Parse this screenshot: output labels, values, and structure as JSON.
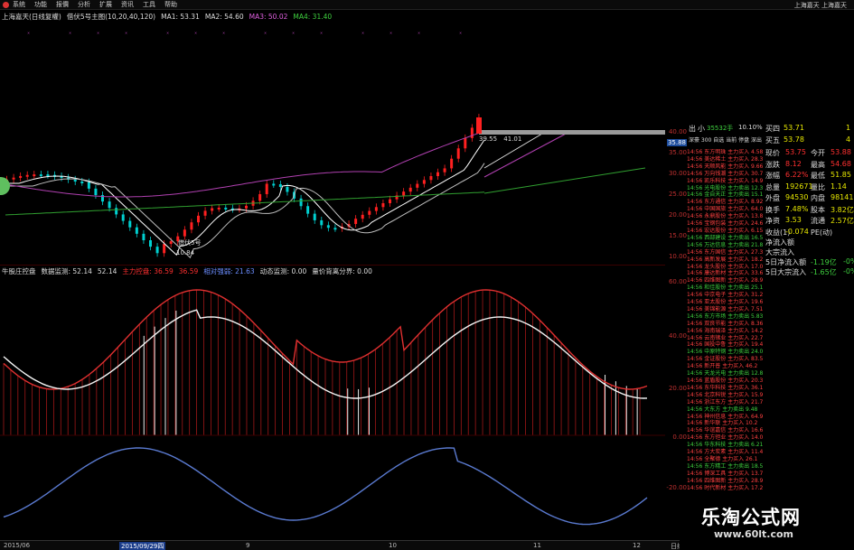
{
  "menu": {
    "items": [
      "系统",
      "功能",
      "报價",
      "分析",
      "扩展",
      "资讯",
      "工具",
      "帮助"
    ],
    "window_title": "上海嘉天  上海嘉天"
  },
  "main_info": {
    "name": "上海嘉天(日线复權)",
    "indicator": "借伏5号主图(10,20,40,120)",
    "ma1": "MA1: 53.31",
    "ma2": "MA2: 54.60",
    "ma3": "MA3: 50.02",
    "ma4": "MA4: 31.40"
  },
  "sub_info": {
    "name": "牛股庄控盘",
    "v1": "数据监测: 52.14",
    "v2": "52.14",
    "v3": "主力控盘: 36.59",
    "v4": "36.59",
    "v5": "相对强弱: 21.63",
    "v6": "动态监测: 0.00",
    "v7": "量价背离分界: 0.00"
  },
  "price_labels": {
    "high_left": "39.55",
    "high_right": "41.01",
    "low": "10.84",
    "buy_label": "借伏5号"
  },
  "price_axis": [
    "40.00",
    "35.00",
    "30.00",
    "25.00",
    "20.00",
    "15.00",
    "10.00"
  ],
  "price_axis_marker": "35.88",
  "sub_axis": [
    "60.00",
    "40.00",
    "20.00",
    "0.00",
    "-20.00"
  ],
  "side_panel": {
    "top_left": "出",
    "top_mid": "小",
    "top_vol": "35532手",
    "top_pct": "10.10%",
    "stock_line": "深豪 300  自选 当前 停盘 深出",
    "buy4_label": "买四",
    "buy4_price": "53.71",
    "buy4_vol": "1",
    "buy5_label": "买五",
    "buy5_price": "53.78",
    "buy5_vol": "4",
    "rows": [
      {
        "l": "现价",
        "v": "53.75",
        "l2": "今开",
        "v2": "53.88"
      },
      {
        "l": "涨跌",
        "v": "8.12",
        "l2": "最高",
        "v2": "54.68"
      },
      {
        "l": "涨幅",
        "v": "6.22%",
        "l2": "最低",
        "v2": "51.85"
      },
      {
        "l": "总量",
        "v": "192671",
        "l2": "量比",
        "v2": "1.14"
      },
      {
        "l": "外盘",
        "v": "94530",
        "l2": "内盘",
        "v2": "98141"
      },
      {
        "l": "换手",
        "v": "7.48%",
        "l2": "股本",
        "v2": "3.82亿"
      },
      {
        "l": "净资",
        "v": "3.53",
        "l2": "流通",
        "v2": "2.57亿"
      },
      {
        "l": "收益(1)",
        "v": "-0.074",
        "l2": "PE(动)",
        "v2": ""
      }
    ]
  },
  "flow": {
    "rows": [
      {
        "l": "净流入额",
        "v": ""
      },
      {
        "l": "大宗流入",
        "v": ""
      },
      {
        "l": "5日净流入额",
        "v": "-1.19亿",
        "v2": "-0%"
      },
      {
        "l": "5日大宗流入",
        "v": "-1.65亿",
        "v2": "-0%"
      }
    ]
  },
  "ticker_rows": [
    "14:56  东方明珠  主力买入  4.58",
    "14:56  美达稀土  主力买入  28.3",
    "14:56  天顺风能  主力买入  9.66",
    "14:56  万向钱潮  主力买入  30.7",
    "14:56  凯乐科技  主力买入  14.9",
    "14:56  光电股份  主力卖出  12.3",
    "14:56  金自天正  主力卖出  15.1",
    "14:56  东方通信  主力买入  8.92",
    "14:56  中国国旅  主力买入  64.0",
    "14:56  永鼎股份  主力买入  13.8",
    "14:56  宝钢包装  主力买入  24.6",
    "14:56  宏达股份  主力买入  6.15",
    "14:56  西部建设  主力卖出  16.5",
    "14:56  万达信息  主力卖出  21.8",
    "14:56  东方国信  主力买入  27.3",
    "14:56  高新发展  主力买入  18.2",
    "14:56  龙头股份  主力买入  17.0",
    "14:56  康达新材  主力买入  33.6",
    "14:56  四维图新  主力买入  28.9",
    "14:56  和佳股份  主力卖出  25.1",
    "14:56  中京电子  主力买入  31.2",
    "14:56  亚太股份  主力买入  19.6",
    "14:56  美锦能源  主力买入  7.51",
    "14:56  东方市场  主力卖出  5.83",
    "14:56  双良节能  主力买入  8.36",
    "14:56  海南瑞泽  主力买入  14.2",
    "14:56  云南锗业  主力买入  22.7",
    "14:56  国投中鲁  主力买入  19.4",
    "14:56  中原特钢  主力卖出  24.0",
    "14:56  金证股份  主力买入  83.5",
    "14:56  新开普  主力买入  46.2",
    "14:56  天龙光电  主力卖出  12.8",
    "14:56  蓝盾股份  主力买入  20.3",
    "14:56  东华科技  主力买入  36.1",
    "14:56  北京科锐  主力买入  15.9",
    "14:56  浙江东方  主力买入  21.7",
    "14:56  大东方  主力卖出  9.48",
    "14:56  神州信息  主力买入  64.9",
    "14:56  新华联  主力买入  10.2",
    "14:56  华谊嘉信  主力买入  16.6",
    "14:56  东方钽业  主力买入  14.0",
    "14:56  华东科技  主力卖出  6.21",
    "14:56  方大炭素  主力买入  11.4",
    "14:56  全聚德  主力买入  26.1",
    "14:56  东方精工  主力卖出  18.5",
    "14:56  博深工具  主力买入  13.7",
    "14:56  四维图新  主力买入  28.9",
    "14:56  时代新材  主力买入  17.2"
  ],
  "time_axis": [
    "2015/06",
    "2015/09/29四",
    "9",
    "10",
    "11",
    "12",
    "日线"
  ],
  "watermark": {
    "main": "乐淘公式网",
    "url": "www.60lt.com"
  },
  "colors": {
    "up": "#ff2020",
    "down": "#00d0d0",
    "ma1": "#ffffff",
    "ma2": "#c8c8c8",
    "ma3": "#b040b0",
    "ma4": "#30a030"
  }
}
